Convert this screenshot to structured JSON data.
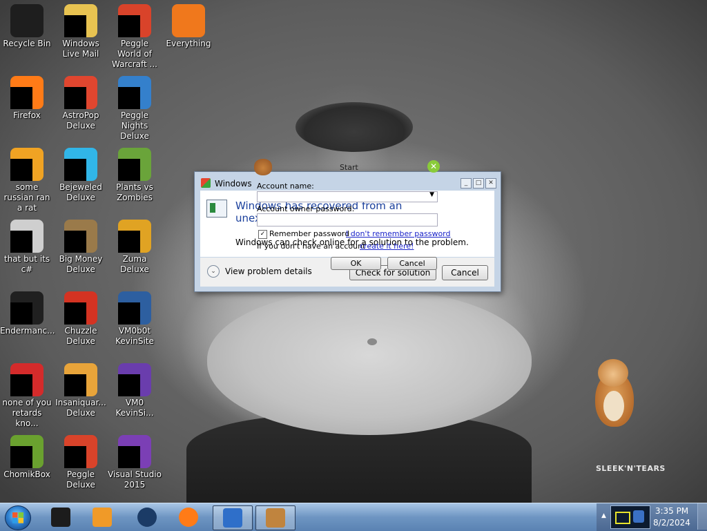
{
  "desktop": {
    "icons": [
      {
        "label": "Recycle Bin",
        "icon": "recycle-bin-icon",
        "color": "#1e1e1e"
      },
      {
        "label": "Windows Live Mail",
        "icon": "mail-icon",
        "color": "#e8c351"
      },
      {
        "label": "Peggle World of Warcraft ...",
        "icon": "peggle-icon",
        "color": "#d9432a"
      },
      {
        "label": "Everything",
        "icon": "everything-icon",
        "color": "#f0781c"
      },
      {
        "label": "Firefox",
        "icon": "firefox-icon",
        "color": "#ff7b17"
      },
      {
        "label": "AstroPop Deluxe",
        "icon": "astropop-icon",
        "color": "#e0462f"
      },
      {
        "label": "Peggle Nights Deluxe",
        "icon": "peggle-nights-icon",
        "color": "#3480cc"
      },
      {
        "label": "some russian ran a rat",
        "icon": "rat-icon",
        "color": "#f0a323"
      },
      {
        "label": "Bejeweled Deluxe",
        "icon": "bejeweled-icon",
        "color": "#31b6e8"
      },
      {
        "label": "Plants vs Zombies",
        "icon": "plants-icon",
        "color": "#6aa43a"
      },
      {
        "label": "that but its c#",
        "icon": "windows-stack-icon",
        "color": "#cfcfcf"
      },
      {
        "label": "Big Money Deluxe",
        "icon": "money-bag-icon",
        "color": "#9a7a4a"
      },
      {
        "label": "Zuma Deluxe",
        "icon": "zuma-icon",
        "color": "#e0a323"
      },
      {
        "label": "Endermanc...",
        "icon": "terminal-icon",
        "color": "#202020"
      },
      {
        "label": "Chuzzle Deluxe",
        "icon": "chuzzle-icon",
        "color": "#d43322"
      },
      {
        "label": "VM0b0t KevinSite",
        "icon": "vm-icon",
        "color": "#2d5fa0"
      },
      {
        "label": "none of you retards kno...",
        "icon": "red-circle-icon",
        "color": "#d42b2b"
      },
      {
        "label": "Insaniquar... Deluxe",
        "icon": "fish-icon",
        "color": "#e8a43a"
      },
      {
        "label": "VM0 KevinSi...",
        "icon": "vm-purple-icon",
        "color": "#6a3dad"
      },
      {
        "label": "ChomikBox",
        "icon": "chomikbox-icon",
        "color": "#6aa12f"
      },
      {
        "label": "Peggle Deluxe",
        "icon": "peggle-deluxe-icon",
        "color": "#d9432a"
      },
      {
        "label": "Visual Studio 2015",
        "icon": "visual-studio-icon",
        "color": "#7b3fb5"
      }
    ]
  },
  "wallpaper": {
    "watermark": "SLEEK'N'TEARS"
  },
  "dialog": {
    "title": "Windows",
    "heading": "Windows has recovered from an unexpected shut",
    "body_text": "Windows can check online for a solution to the problem.",
    "view_details": "View problem details",
    "check_button": "Check for solution",
    "cancel_button": "Cancel"
  },
  "overlay": {
    "account_name_label": "Account name:",
    "owner_password_label": "Account owner password:",
    "remember_password": "Remember password",
    "forgot_link": "I don't remember password",
    "no_account_text": "If you don't have an account -",
    "create_link": "create it here!",
    "ok_button": "OK",
    "cancel_button": "Cancel",
    "login_label": "Start"
  },
  "taskbar": {
    "apps": [
      {
        "name": "taskbar-app-dark",
        "icon": "black-box-icon",
        "color": "#1c1c1c"
      },
      {
        "name": "taskbar-app-media",
        "icon": "media-player-icon",
        "color": "#f09a28"
      },
      {
        "name": "taskbar-app-globe",
        "icon": "globe-icon",
        "color": "#1b3b66"
      },
      {
        "name": "taskbar-app-firefox",
        "icon": "firefox-icon",
        "color": "#ff7b17"
      },
      {
        "name": "taskbar-app-check",
        "icon": "checklist-icon",
        "color": "#2f6fc9"
      },
      {
        "name": "taskbar-app-chomikbox",
        "icon": "chomikbox-icon",
        "color": "#c0843e"
      }
    ],
    "time": "3:35 PM",
    "date": "8/2/2024"
  }
}
